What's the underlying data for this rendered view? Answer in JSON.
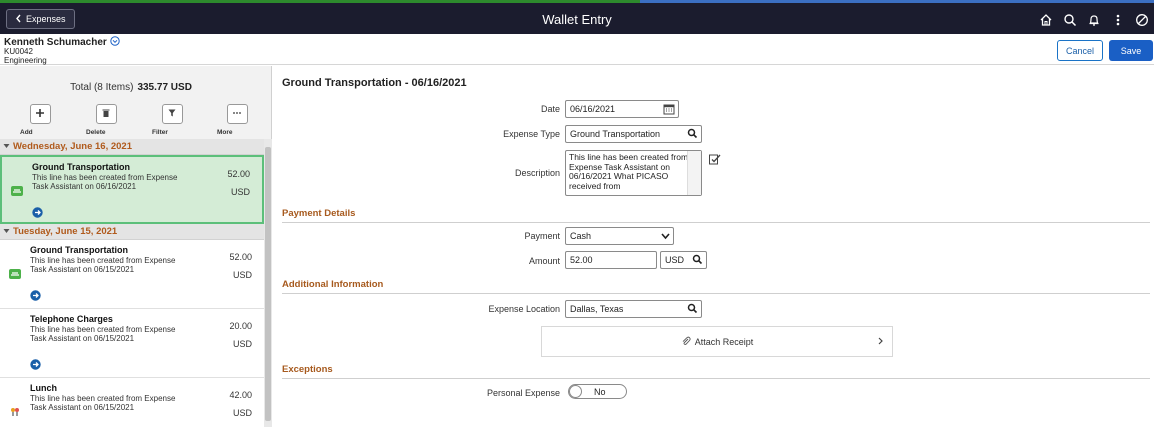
{
  "app": {
    "title": "Wallet Entry",
    "back_label": "Expenses"
  },
  "employee": {
    "name": "Kenneth Schumacher",
    "id": "KU0042",
    "department": "Engineering"
  },
  "buttons": {
    "cancel": "Cancel",
    "save": "Save"
  },
  "left": {
    "total_label": "Total (8 Items)",
    "total_amount": "335.77 USD",
    "actions": {
      "add": "Add",
      "delete": "Delete",
      "filter": "Filter",
      "more": "More"
    },
    "groups": [
      {
        "date": "Wednesday, June 16, 2021",
        "items": [
          {
            "title": "Ground Transportation",
            "desc": "This line has been created from Expense Task Assistant on 06/16/2021",
            "amount": "52.00",
            "currency": "USD",
            "icon": "car-icon"
          }
        ]
      },
      {
        "date": "Tuesday, June 15, 2021",
        "items": [
          {
            "title": "Ground Transportation",
            "desc": "This line has been created from Expense Task Assistant on 06/15/2021",
            "amount": "52.00",
            "currency": "USD",
            "icon": "car-icon"
          },
          {
            "title": "Telephone Charges",
            "desc": "This line has been created from Expense Task Assistant on 06/15/2021",
            "amount": "20.00",
            "currency": "USD",
            "icon": ""
          },
          {
            "title": "Lunch",
            "desc": "This line has been created from Expense Task Assistant on 06/15/2021",
            "amount": "42.00",
            "currency": "USD",
            "icon": "utensils-icon"
          }
        ]
      }
    ]
  },
  "form": {
    "title": "Ground Transportation - 06/16/2021",
    "date_label": "Date",
    "date_value": "06/16/2021",
    "expense_type_label": "Expense Type",
    "expense_type_value": "Ground Transportation",
    "description_label": "Description",
    "description_value": "This line has been created from Expense Task Assistant on 06/16/2021 What PICASO received from",
    "payment_details": "Payment Details",
    "payment_label": "Payment",
    "payment_value": "Cash",
    "amount_label": "Amount",
    "amount_value": "52.00",
    "currency_value": "USD",
    "additional_information": "Additional Information",
    "expense_location_label": "Expense Location",
    "expense_location_value": "Dallas, Texas",
    "attach_receipt": "Attach Receipt",
    "exceptions": "Exceptions",
    "personal_expense_label": "Personal Expense",
    "personal_expense_value": "No"
  }
}
